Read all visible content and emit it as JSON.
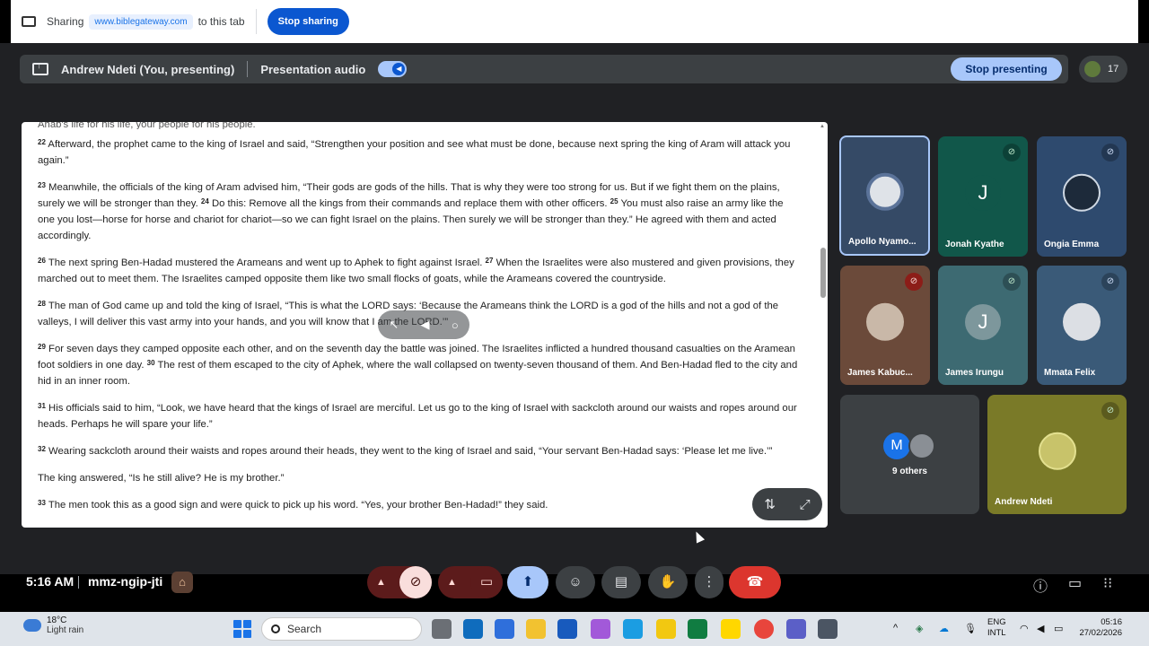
{
  "share_bar": {
    "sharing_label": "Sharing",
    "site": "www.biblegateway.com",
    "to_tab": "to this tab",
    "stop_sharing": "Stop sharing"
  },
  "present_bar": {
    "presenter": "Andrew Ndeti (You, presenting)",
    "audio_label": "Presentation audio",
    "stop_presenting": "Stop presenting",
    "participant_count": "17"
  },
  "document": {
    "cut_line": "Ahab's life for his life, your people for his people.",
    "verses": [
      {
        "n": "22",
        "text": "Afterward, the prophet came to the king of Israel and said, “Strengthen your position and see what must be done, because next spring the king of Aram will attack you again.”"
      },
      {
        "n": "23",
        "text": "Meanwhile, the officials of the king of Aram advised him, “Their gods are gods of the hills. That is why they were too strong for us. But if we fight them on the plains, surely we will be stronger than they."
      },
      {
        "n": "24",
        "text": "Do this: Remove all the kings from their commands and replace them with other officers."
      },
      {
        "n": "25",
        "text": "You must also raise an army like the one you lost—horse for horse and chariot for chariot—so we can fight Israel on the plains. Then surely we will be stronger than they.” He agreed with them and acted accordingly."
      },
      {
        "n": "26",
        "text": "The next spring Ben-Hadad mustered the Arameans and went up to Aphek to fight against Israel."
      },
      {
        "n": "27",
        "text": "When the Israelites were also mustered and given provisions, they marched out to meet them. The Israelites camped opposite them like two small flocks of goats, while the Arameans covered the countryside."
      },
      {
        "n": "28",
        "text": "The man of God came up and told the king of Israel, “This is what the LORD says: ‘Because the Arameans think the LORD is a god of the hills and not a god of the valleys, I will deliver this vast army into your hands, and you will know that I am the LORD.’”"
      },
      {
        "n": "29",
        "text": "For seven days they camped opposite each other, and on the seventh day the battle was joined. The Israelites inflicted a hundred thousand casualties on the Aramean foot soldiers in one day."
      },
      {
        "n": "30",
        "text": "The rest of them escaped to the city of Aphek, where the wall collapsed on twenty-seven thousand of them. And Ben-Hadad fled to the city and hid in an inner room."
      },
      {
        "n": "31",
        "text": "His officials said to him, “Look, we have heard that the kings of Israel are merciful. Let us go to the king of Israel with sackcloth around our waists and ropes around our heads. Perhaps he will spare your life.”"
      },
      {
        "n": "32",
        "text": "Wearing sackcloth around their waists and ropes around their heads, they went to the king of Israel and said, “Your servant Ben-Hadad says: ‘Please let me live.’”"
      },
      {
        "n": "",
        "text": "The king answered, “Is he still alive? He is my brother.”"
      },
      {
        "n": "33",
        "text": "The men took this as a good sign and were quick to pick up his word. “Yes, your brother Ben-Hadad!” they said."
      }
    ]
  },
  "tiles": {
    "t1": "Apollo Nyamo...",
    "t2": "Jonah Kyathe",
    "t2_letter": "J",
    "t3": "Ongia Emma",
    "t4": "James Kabuc...",
    "t5": "James Irungu",
    "t5_letter": "J",
    "t6": "Mmata Felix",
    "t7": "9 others",
    "t7_letter": "M",
    "t8": "Andrew Ndeti"
  },
  "bottom": {
    "time": "5:16 AM",
    "meeting_code": "mmz-ngip-jti"
  },
  "taskbar": {
    "temp": "18°C",
    "weather": "Light rain",
    "search": "Search",
    "lang1": "ENG",
    "lang2": "INTL",
    "clock_time": "05:16",
    "clock_date": "27/02/2026"
  }
}
